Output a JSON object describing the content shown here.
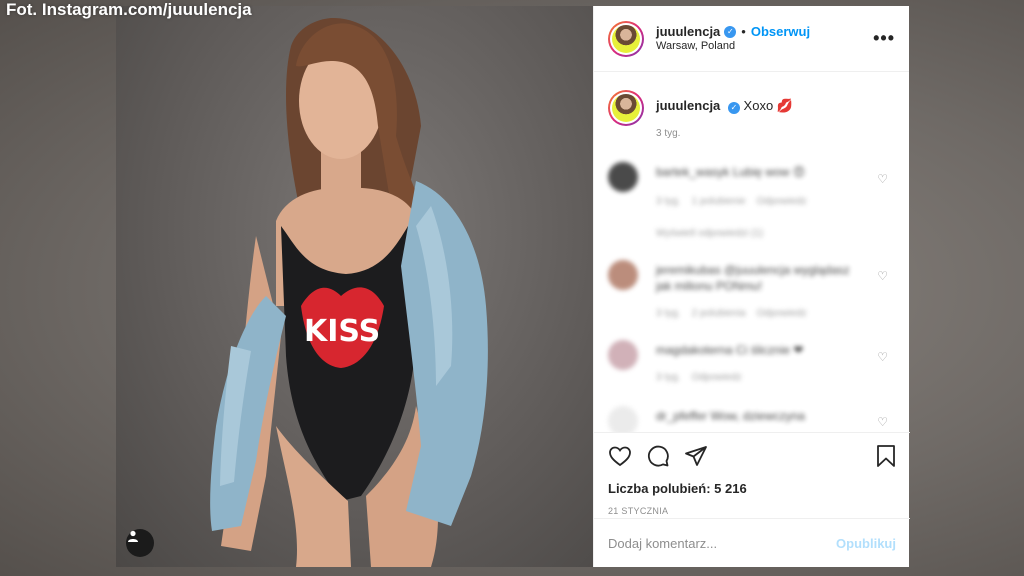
{
  "credit": "Fot. Instagram.com/juuulencja",
  "post": {
    "username": "juuulencja",
    "follow_label": "Obserwuj",
    "location": "Warsaw, Poland",
    "more_label": "•••",
    "caption_username": "juuulencja",
    "caption_text": "Xoxo 💋",
    "caption_time": "3 tyg.",
    "likes": "Liczba polubień: 5 216",
    "date": "21 stycznia",
    "comment_placeholder": "Dodaj komentarz...",
    "publish_label": "Opublikuj"
  },
  "shirt_text": "KISS",
  "comments": [
    {
      "text": "bartek_wasyk Lubię wow 😍",
      "time": "3 tyg.",
      "likes": "1 polubienie",
      "reply": "Odpowiedz",
      "extra": "Wyświetl odpowiedzi (1)"
    },
    {
      "text": "jeremikubas @juuulencja wyglądasz jak milionu PONmu!",
      "time": "3 tyg.",
      "likes": "2 polubienia",
      "reply": "Odpowiedz",
      "extra": ""
    },
    {
      "text": "magdakoterna Ci ślicznie ❤",
      "time": "3 tyg.",
      "likes": "",
      "reply": "Odpowiedz",
      "extra": ""
    },
    {
      "text": "dr_pfeffer Wow, dziewczyna",
      "time": "",
      "likes": "",
      "reply": "",
      "extra": ""
    }
  ],
  "icons": {
    "heart": "heart-icon",
    "comment": "comment-icon",
    "share": "share-icon",
    "save": "bookmark-icon",
    "more": "more-icon",
    "user_tag": "user-icon"
  }
}
